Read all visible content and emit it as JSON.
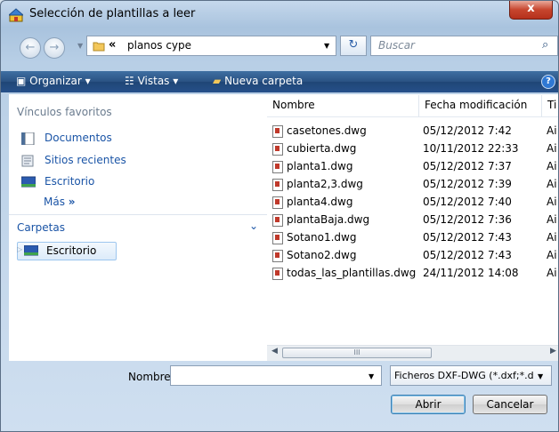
{
  "window": {
    "title": "Selección de plantillas a leer",
    "close_label": "x"
  },
  "address": {
    "back_glyph": "←",
    "forward_glyph": "→",
    "overflow": "«",
    "current_folder": "planos cype",
    "refresh_glyph": "↻",
    "search_placeholder": "Buscar",
    "search_glyph": "⌕"
  },
  "toolbar": {
    "organize": "Organizar",
    "views": "Vistas",
    "new_folder": "Nueva carpeta",
    "help": "?"
  },
  "navigation": {
    "favorites_header": "Vínculos favoritos",
    "favorites": [
      {
        "label": "Documentos",
        "icon": "documents-icon"
      },
      {
        "label": "Sitios recientes",
        "icon": "recent-places-icon"
      },
      {
        "label": "Escritorio",
        "icon": "desktop-icon"
      }
    ],
    "more": "Más",
    "folders_header": "Carpetas",
    "tree": [
      {
        "label": "Escritorio",
        "icon": "desktop-icon"
      }
    ]
  },
  "file_list": {
    "columns": [
      "Nombre",
      "Fecha modificación",
      "Ti"
    ],
    "rows": [
      {
        "name": "casetones.dwg",
        "date": "05/12/2012 7:42",
        "type": "Ai"
      },
      {
        "name": "cubierta.dwg",
        "date": "10/11/2012 22:33",
        "type": "Ai"
      },
      {
        "name": "planta1.dwg",
        "date": "05/12/2012 7:37",
        "type": "Ai"
      },
      {
        "name": "planta2,3.dwg",
        "date": "05/12/2012 7:39",
        "type": "Ai"
      },
      {
        "name": "planta4.dwg",
        "date": "05/12/2012 7:40",
        "type": "Ai"
      },
      {
        "name": "plantaBaja.dwg",
        "date": "05/12/2012 7:36",
        "type": "Ai"
      },
      {
        "name": "Sotano1.dwg",
        "date": "05/12/2012 7:43",
        "type": "Ai"
      },
      {
        "name": "Sotano2.dwg",
        "date": "05/12/2012 7:43",
        "type": "Ai"
      },
      {
        "name": "todas_las_plantillas.dwg",
        "date": "24/11/2012 14:08",
        "type": "Ai"
      }
    ],
    "scroll_thumb_grip": "III"
  },
  "footer": {
    "filename_label": "Nombre:",
    "filename_value": "",
    "filter": "Ficheros DXF-DWG (*.dxf;*.d",
    "open_button": "Abrir",
    "cancel_button": "Cancelar"
  },
  "colors": {
    "toolbar_bg": "#26508a",
    "link_blue": "#1a54a6",
    "close_red": "#c7452e"
  }
}
